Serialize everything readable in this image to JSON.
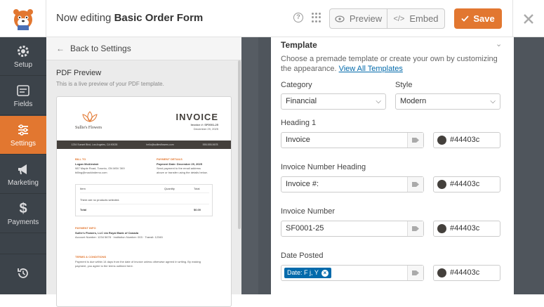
{
  "header": {
    "title_prefix": "Now editing",
    "form_name": "Basic Order Form",
    "preview_label": "Preview",
    "embed_label": "Embed",
    "save_label": "Save"
  },
  "sidebar": {
    "items": [
      {
        "label": "Setup",
        "icon": "gear-icon"
      },
      {
        "label": "Fields",
        "icon": "fields-icon"
      },
      {
        "label": "Settings",
        "icon": "sliders-icon",
        "active": true
      },
      {
        "label": "Marketing",
        "icon": "megaphone-icon"
      },
      {
        "label": "Payments",
        "icon": "dollar-icon"
      }
    ]
  },
  "settings_panel": {
    "back_label": "Back to Settings",
    "pdf_heading": "PDF Preview",
    "pdf_subtext": "This is a live preview of your PDF template."
  },
  "invoice_preview": {
    "company": "Sullie's Flowers",
    "title": "INVOICE",
    "number_line": "Invoice #: SF0001-25",
    "date_line": "December 29, 2025",
    "bar_address": "1234 Sunset Blvd, Los Angeles, CA 90028",
    "bar_email": "hello@sulliesflowers.com",
    "bar_phone": "555-555-5678",
    "bill_to_label": "BILL TO",
    "bill_to_lines": [
      "Logan McAlestair",
      "987 Maple Road, Toronto, ON M5V 3K9",
      "billing@mackindemo.com"
    ],
    "payment_label": "PAYMENT DETAILS",
    "payment_lines": [
      "Payment Date: December 29, 2025",
      "Send payment to the email address",
      "above or transfer using the details below."
    ],
    "table_headers": [
      "Item",
      "Quantity",
      "Total"
    ],
    "table_empty": "There are no products selected.",
    "table_total_label": "Total",
    "table_total_value": "$0.00",
    "payment_info_label": "PAYMENT INFO",
    "payment_info_lines": [
      "Sullie's Flowers, LLC via Royal Bank of Canada",
      "Account Number: 1234 5678 · Institution Number: 003 · Transit: 12345"
    ],
    "terms_label": "TERMS & CONDITIONS",
    "terms_lines": [
      "Payment is due within 14 days from the date of invoice unless otherwise agreed in writing. By making",
      "payment, you agree to the terms outlined here."
    ]
  },
  "template_section": {
    "title": "Template",
    "description": "Choose a premade template or create your own by customizing the appearance.",
    "link_text": "View All Templates",
    "category_label": "Category",
    "category_value": "Financial",
    "style_label": "Style",
    "style_value": "Modern",
    "fields": [
      {
        "label": "Heading 1",
        "value": "Invoice",
        "color": "#44403c"
      },
      {
        "label": "Invoice Number Heading",
        "value": "Invoice #:",
        "color": "#44403c"
      },
      {
        "label": "Invoice Number",
        "value": "SF0001-25",
        "color": "#44403c"
      },
      {
        "label": "Date Posted",
        "chip": "Date: F j, Y",
        "color": "#44403c"
      }
    ]
  }
}
